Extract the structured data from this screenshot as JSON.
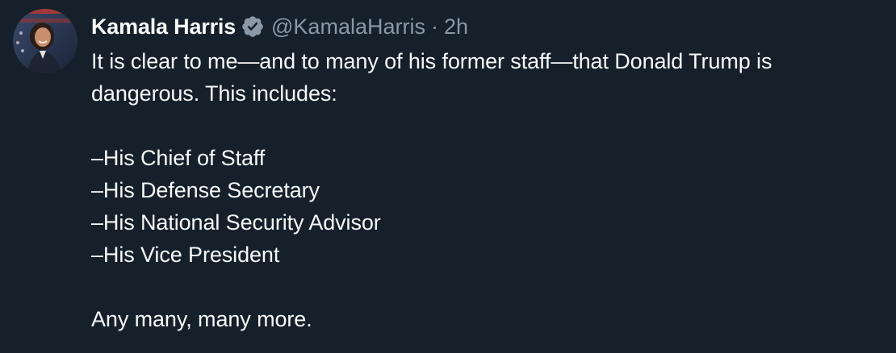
{
  "tweet": {
    "display_name": "Kamala Harris",
    "handle": "@KamalaHarris",
    "separator": "·",
    "timestamp": "2h",
    "verified_icon": "verified-badge-icon",
    "lines": [
      "It is clear to me—and to many of his former staff—that Donald Trump is",
      "dangerous. This includes:",
      "",
      "–His Chief of Staff",
      "–His Defense Secretary",
      "–His National Security Advisor",
      "–His Vice President",
      "",
      "Any many, many more."
    ]
  },
  "colors": {
    "background": "#15202b",
    "text": "#f7f9f9",
    "secondary_text": "#8b98a5",
    "verified_badge": "#8b98a5"
  }
}
